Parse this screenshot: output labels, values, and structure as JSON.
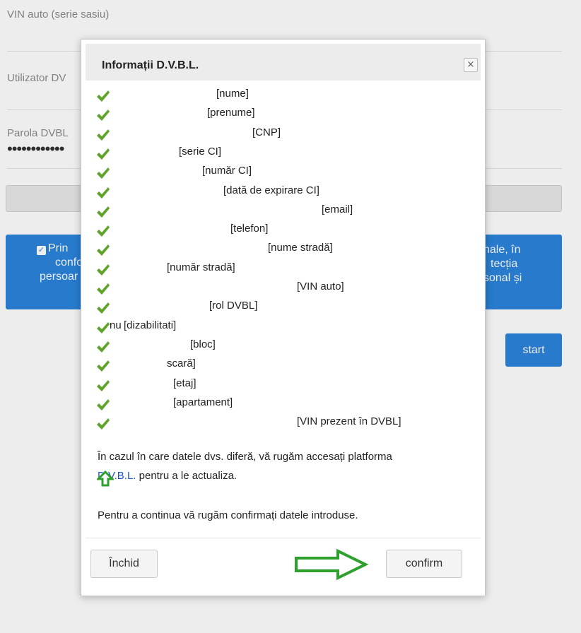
{
  "background": {
    "vin_label": "VIN auto (serie sasiu)",
    "user_label_partial": "Utilizator DV",
    "password_label_partial": "Parola DVBL",
    "password_dots": "••••••••••••",
    "consent_left": [
      "Prin",
      "confo",
      "persoar"
    ],
    "consent_right": [
      "nale, în",
      "tecția",
      "sonal și"
    ],
    "start_label": "start"
  },
  "modal": {
    "title": "Informații D.V.B.L.",
    "close_symbol": "×",
    "check_color": "#5fa32b",
    "fields": [
      {
        "prefix": "",
        "label": "[nume]"
      },
      {
        "prefix": "",
        "label": "[prenume]"
      },
      {
        "prefix": "",
        "label": "[CNP]"
      },
      {
        "prefix": "",
        "label": "[serie CI]"
      },
      {
        "prefix": "",
        "label": "[număr CI]"
      },
      {
        "prefix": "",
        "label": "[dată de expirare CI]"
      },
      {
        "prefix": "",
        "label": "[email]"
      },
      {
        "prefix": "",
        "label": "[telefon]"
      },
      {
        "prefix": "",
        "label": "[nume stradă]"
      },
      {
        "prefix": "",
        "label": "[număr stradă]"
      },
      {
        "prefix": "",
        "label": "[VIN auto]"
      },
      {
        "prefix": "",
        "label": "[rol DVBL]"
      },
      {
        "prefix": "nu",
        "label": "[dizabilitati]"
      },
      {
        "prefix": "",
        "label": "[bloc]"
      },
      {
        "prefix": "",
        "label": "scară]"
      },
      {
        "prefix": "",
        "label": "[etaj]"
      },
      {
        "prefix": "",
        "label": "[apartament]"
      },
      {
        "prefix": "",
        "label": "[VIN prezent în DVBL]"
      }
    ],
    "info_line1": "În cazul în care datele dvs. diferă, vă rugăm accesați platforma",
    "info_link": "D.V.B.L.",
    "info_line2_rest": " pentru a le actualiza.",
    "info_line3": "Pentru a continua vă rugăm confirmați datele introduse.",
    "close_button": "Închid",
    "confirm_button": "confirm",
    "arrow_color": "#2ea02e"
  }
}
